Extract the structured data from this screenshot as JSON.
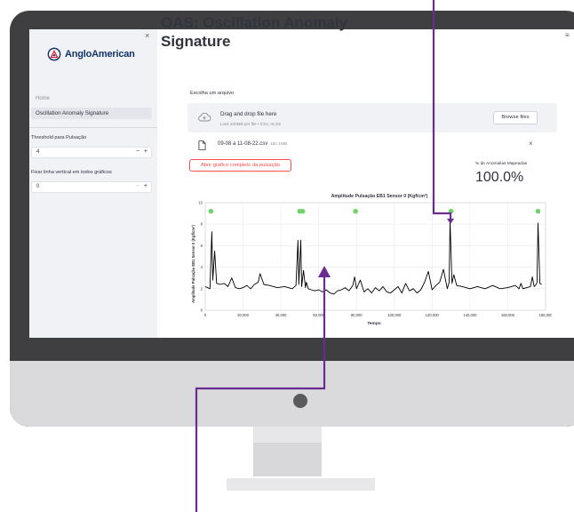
{
  "app": {
    "brand": "AngloAmerican",
    "title": "OAS: Oscillation Anomaly Signature"
  },
  "sidebar": {
    "close_glyph": "×",
    "nav": {
      "home": "Home",
      "current": "Oscillation Anomaly Signature"
    },
    "threshold": {
      "label": "Threshold para Pulsação",
      "value": "4",
      "minus": "−",
      "plus": "+"
    },
    "vline": {
      "label": "Fixar linha vertical em todos gráficos",
      "value": "0",
      "minus": "−",
      "plus": "+"
    }
  },
  "menu_glyph": "≡",
  "upload": {
    "label": "Escolha um arquivo",
    "drag_text": "Drag and drop file here",
    "limit_text": "Limit 400MB per file • CSV, XLSX",
    "browse_label": "Browse files",
    "file_name": "09-08 a 11-08-22.csv",
    "file_size": "181.1MB",
    "remove_glyph": "×"
  },
  "full_pulse_button": "Abrir gráfico completo da pulsação",
  "metric": {
    "label": "% de Anomalias Mapeadas",
    "value": "100.0%"
  },
  "colors": {
    "brand_blue": "#14336b",
    "brand_red": "#e4202e",
    "accent_red": "#ff4b4b",
    "marker_green": "#6fd36a",
    "annotation_purple": "#6a2c91"
  },
  "chart_data": {
    "type": "line",
    "title": "Amplitude Pulsação EB1 Sensor 0 (Kgf/cm²)",
    "xlabel": "Tempo",
    "ylabel": "Amplitude Pulsação EB1 Sensor 0 (Kgf/cm²)",
    "xlim": [
      0,
      180000
    ],
    "ylim": [
      0,
      10
    ],
    "xticks": [
      "0",
      "20,000",
      "40,000",
      "60,000",
      "80,000",
      "100,000",
      "120,000",
      "140,000",
      "160,000",
      "180,000"
    ],
    "yticks": [
      "0",
      "2",
      "4",
      "6",
      "8",
      "10"
    ],
    "grid": true,
    "series": [
      {
        "x": [
          0,
          2500,
          3500,
          4000,
          5000,
          6000,
          8000,
          10000,
          12000,
          14000,
          16000,
          18000,
          20000,
          22000,
          24000,
          26000,
          28000,
          29000,
          31000,
          34000,
          38000,
          42000,
          46000,
          48000,
          49000,
          49500,
          50500,
          51000,
          52000,
          53000,
          53500,
          54500,
          56000,
          58000,
          60000,
          62000,
          64000,
          66000,
          68000,
          70000,
          72000,
          74000,
          76000,
          78000,
          79000,
          80000,
          81000,
          82000,
          84000,
          86000,
          88000,
          90000,
          92000,
          94000,
          96000,
          98000,
          100000,
          102000,
          104000,
          106000,
          108000,
          110000,
          112000,
          114000,
          116000,
          118000,
          120000,
          122000,
          124000,
          126000,
          128000,
          129000,
          129500,
          130500,
          131500,
          133000,
          136000,
          140000,
          144000,
          148000,
          152000,
          156000,
          160000,
          164000,
          166000,
          167000,
          168000,
          170000,
          172000,
          173000,
          174000,
          175000,
          175500,
          176000,
          177000,
          178000
        ],
        "y": [
          2.2,
          2.0,
          7.3,
          2.8,
          5.5,
          2.5,
          2.4,
          2.5,
          2.2,
          3.0,
          2.1,
          2.0,
          2.1,
          2.3,
          2.0,
          2.4,
          2.6,
          3.4,
          2.4,
          2.3,
          2.1,
          2.2,
          2.0,
          2.3,
          6.5,
          2.4,
          6.5,
          2.2,
          3.7,
          2.1,
          2.6,
          2.0,
          1.9,
          1.8,
          1.9,
          1.7,
          1.9,
          1.6,
          1.5,
          1.8,
          1.9,
          2.1,
          1.8,
          2.3,
          3.1,
          2.0,
          2.4,
          2.8,
          1.7,
          2.0,
          1.6,
          2.1,
          1.8,
          2.2,
          1.7,
          1.6,
          1.9,
          2.2,
          1.6,
          2.5,
          1.8,
          2.0,
          1.6,
          1.9,
          2.6,
          3.6,
          1.9,
          2.3,
          2.6,
          3.8,
          2.0,
          2.6,
          8.3,
          2.5,
          3.3,
          2.3,
          2.2,
          2.0,
          2.2,
          2.0,
          2.3,
          2.0,
          2.1,
          2.3,
          2.0,
          2.5,
          2.0,
          2.1,
          2.2,
          3.1,
          2.2,
          2.4,
          2.6,
          8.1,
          2.5,
          2.4
        ]
      },
      {
        "name": "",
        "type": "scatter",
        "x": [
          3000,
          50000,
          51500,
          79500,
          130000,
          176000
        ],
        "y": [
          9.2,
          9.2,
          9.2,
          9.2,
          9.2,
          9.2
        ]
      }
    ]
  }
}
